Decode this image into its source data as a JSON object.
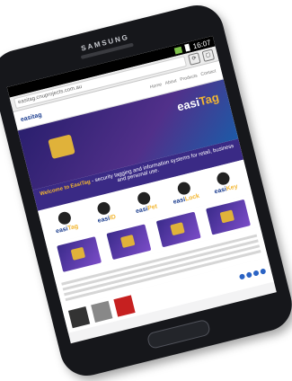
{
  "device": {
    "brand": "SAMSUNG"
  },
  "statusbar": {
    "time": "16:07"
  },
  "browser": {
    "url": "easitag.cnuprojects.com.au"
  },
  "site": {
    "logo_small": "easitag",
    "nav": [
      "Home",
      "About",
      "Products",
      "Contact"
    ],
    "hero_logo": "easi",
    "hero_logo_accent": "Tag",
    "tagline_prefix": "Welcome to EasiTag",
    "tagline_rest": " - security tagging and information systems for retail, business and personal use.",
    "products": [
      {
        "name": "easi",
        "accent": "Tag"
      },
      {
        "name": "easi",
        "accent": "ID"
      },
      {
        "name": "easi",
        "accent": "Pet"
      },
      {
        "name": "easi",
        "accent": "Lock"
      },
      {
        "name": "easi",
        "accent": "Key"
      }
    ]
  }
}
